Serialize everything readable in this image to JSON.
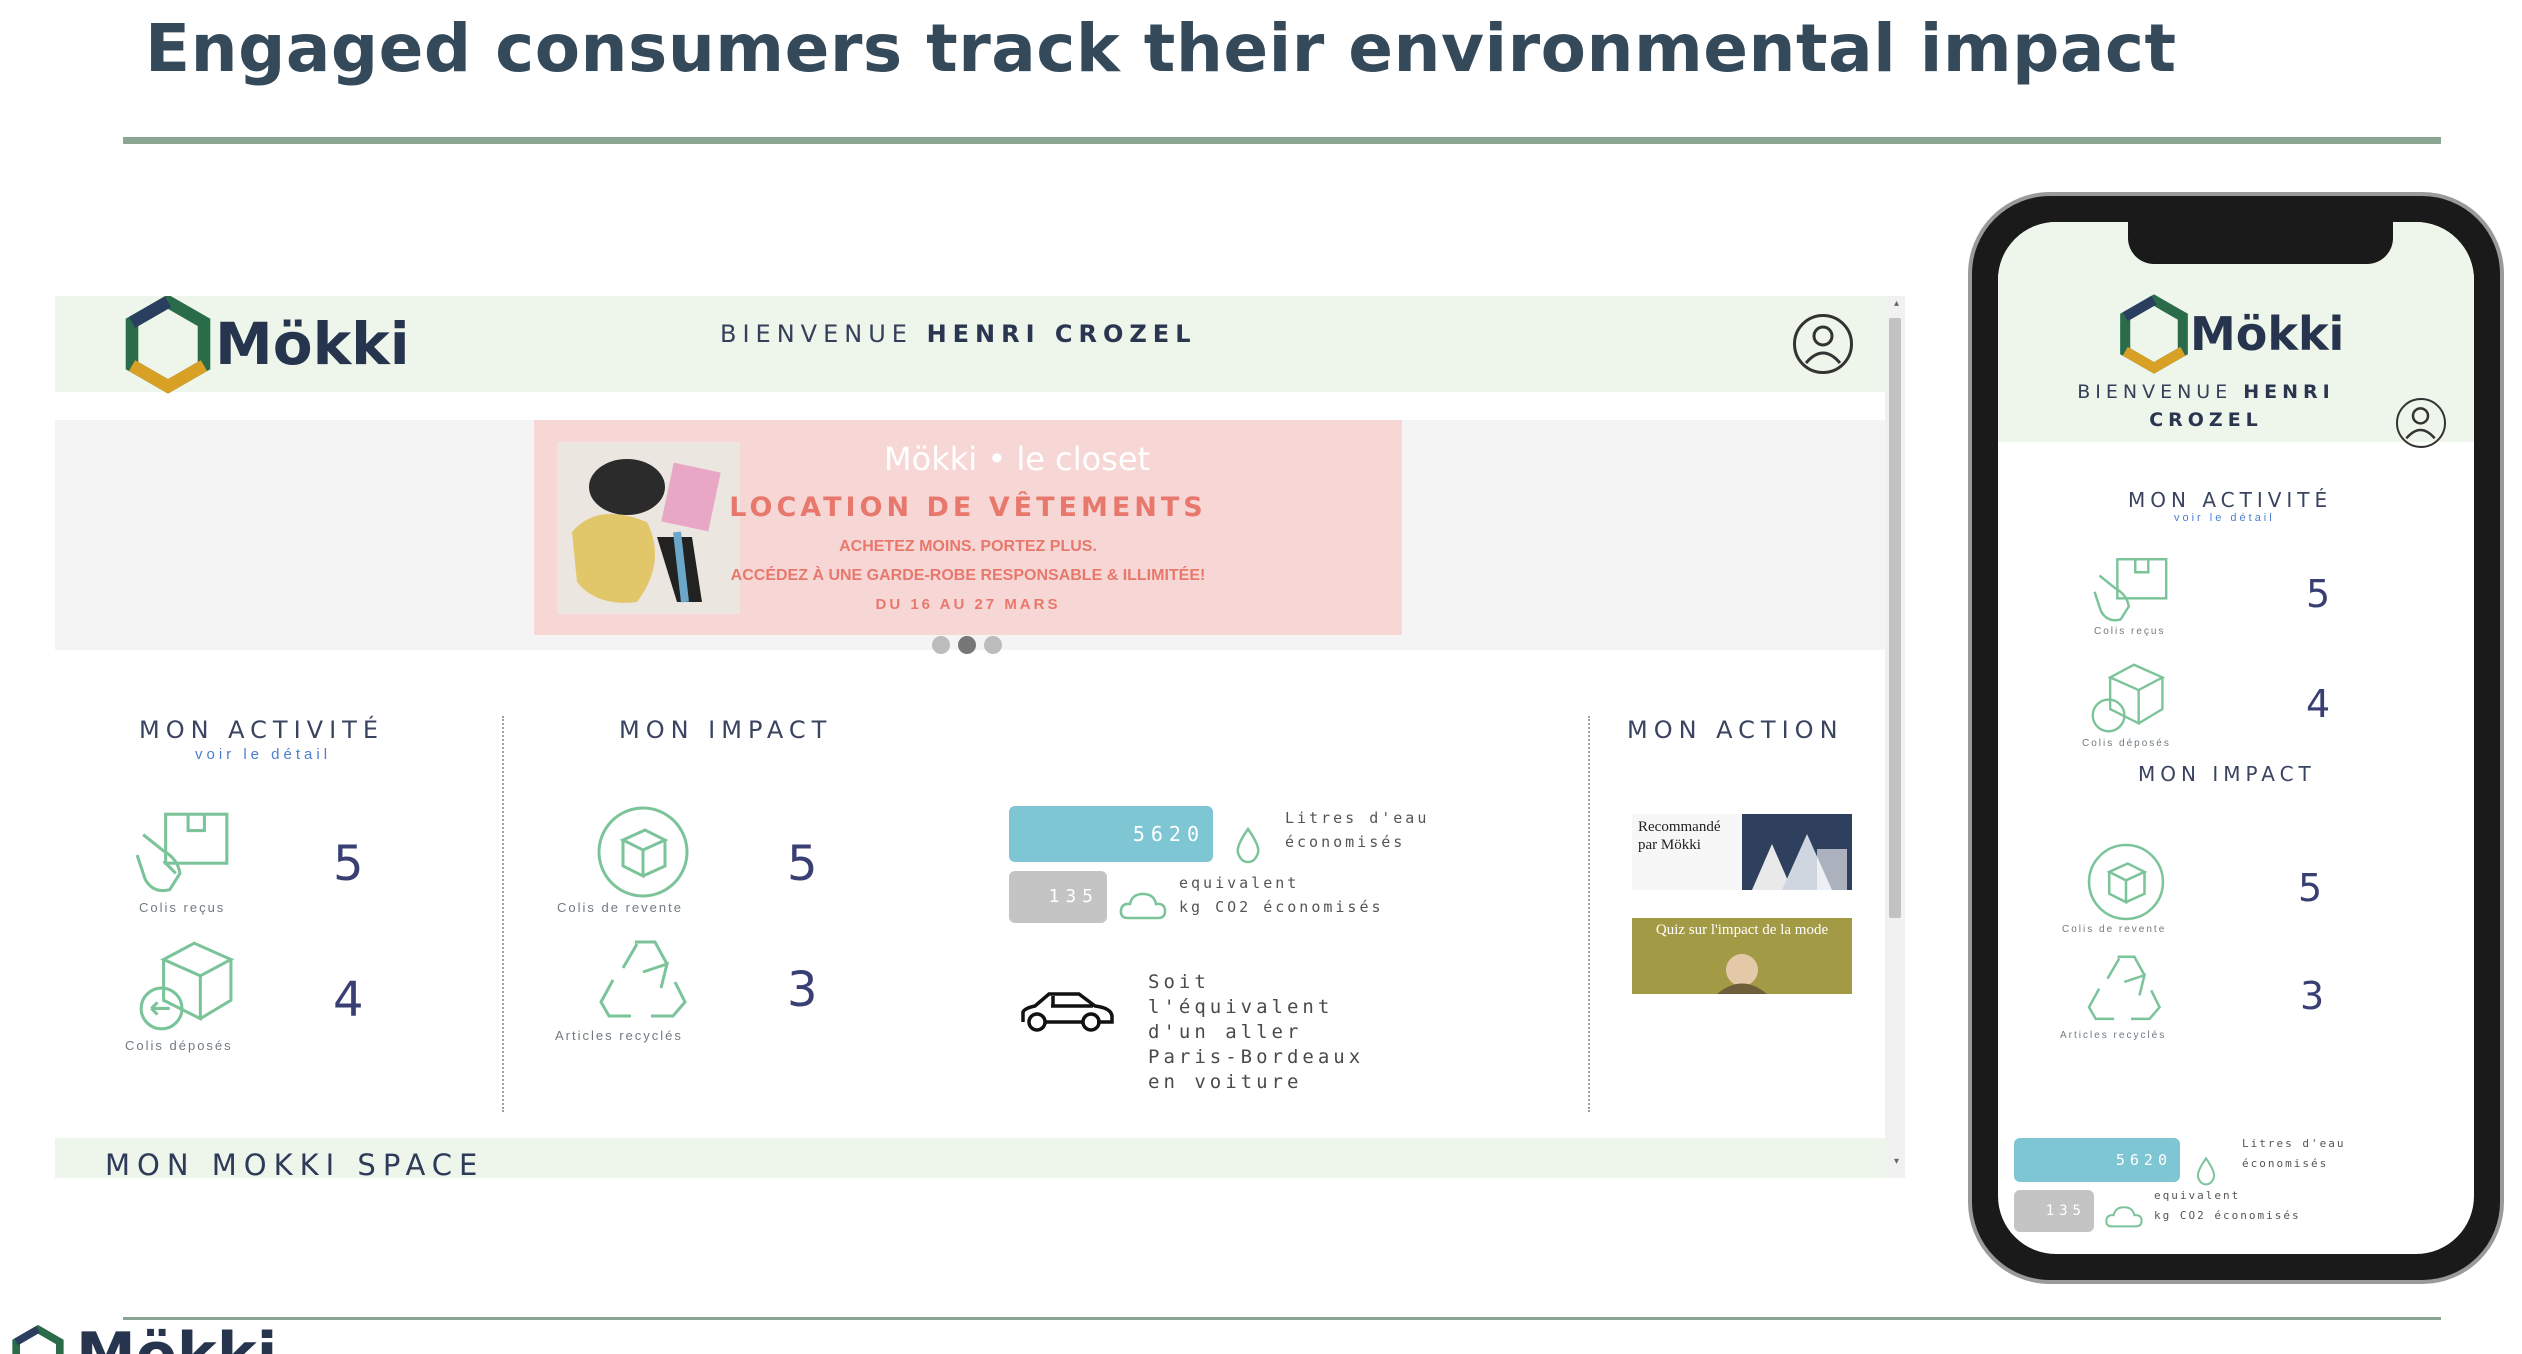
{
  "slide": {
    "title": "Engaged consumers track their environmental impact"
  },
  "brand": {
    "name": "Mökki",
    "accent_green": "#8aa592",
    "header_bg": "#eef5ea",
    "hex_colors": [
      "#2a6b4a",
      "#d8a126",
      "#2a3f5f"
    ]
  },
  "desktop": {
    "welcome_prefix": "BIENVENUE",
    "welcome_name": "HENRI CROZEL",
    "banner": {
      "brand_line": "Mökki • le closet",
      "title": "LOCATION DE VÊTEMENTS",
      "line1": "ACHETEZ MOINS. PORTEZ PLUS.",
      "line2": "ACCÉDEZ À UNE GARDE-ROBE RESPONSABLE & ILLIMITÉE!",
      "line3": "DU 16 AU 27 MARS",
      "dots_total": 3,
      "dots_active": 2
    },
    "activity": {
      "title": "MON ACTIVITÉ",
      "link": "voir le détail",
      "received_caption": "Colis reçus",
      "received_value": "5",
      "deposited_caption": "Colis déposés",
      "deposited_value": "4"
    },
    "impact": {
      "title": "MON IMPACT",
      "resale_caption": "Colis de revente",
      "resale_value": "5",
      "recycled_caption": "Articles recyclés",
      "recycled_value": "3",
      "water_value": "5620",
      "water_label_1": "Litres d'eau",
      "water_label_2": "économisés",
      "co2_value": "135",
      "co2_label_1": "equivalent",
      "co2_label_2": "kg CO2 économisés",
      "car_text": "Soit l'équivalent d'un aller Paris-Bordeaux en voiture",
      "water_bar_color": "#7fc6d4",
      "co2_bar_color": "#c4c4c4"
    },
    "action": {
      "title": "MON ACTION",
      "tile1_text": "Recommandé par Mökki",
      "tile2_text": "Quiz sur l'impact de la mode"
    },
    "space_title": "MON MOKKI SPACE"
  },
  "phone": {
    "welcome_prefix": "BIENVENUE",
    "welcome_name_1": "HENRI",
    "welcome_name_2": "CROZEL",
    "activity_title": "MON ACTIVITÉ",
    "activity_link": "voir le détail",
    "received_caption": "Colis reçus",
    "received_value": "5",
    "deposited_caption": "Colis déposés",
    "deposited_value": "4",
    "impact_title": "MON IMPACT",
    "resale_caption": "Colis de revente",
    "resale_value": "5",
    "recycled_caption": "Articles recyclés",
    "recycled_value": "3",
    "water_value": "5620",
    "water_label_1": "Litres d'eau",
    "water_label_2": "économisés",
    "co2_value": "135",
    "co2_label_1": "equivalent",
    "co2_label_2": "kg CO2 économisés"
  },
  "footer": {
    "logo_text": "Mökki"
  }
}
